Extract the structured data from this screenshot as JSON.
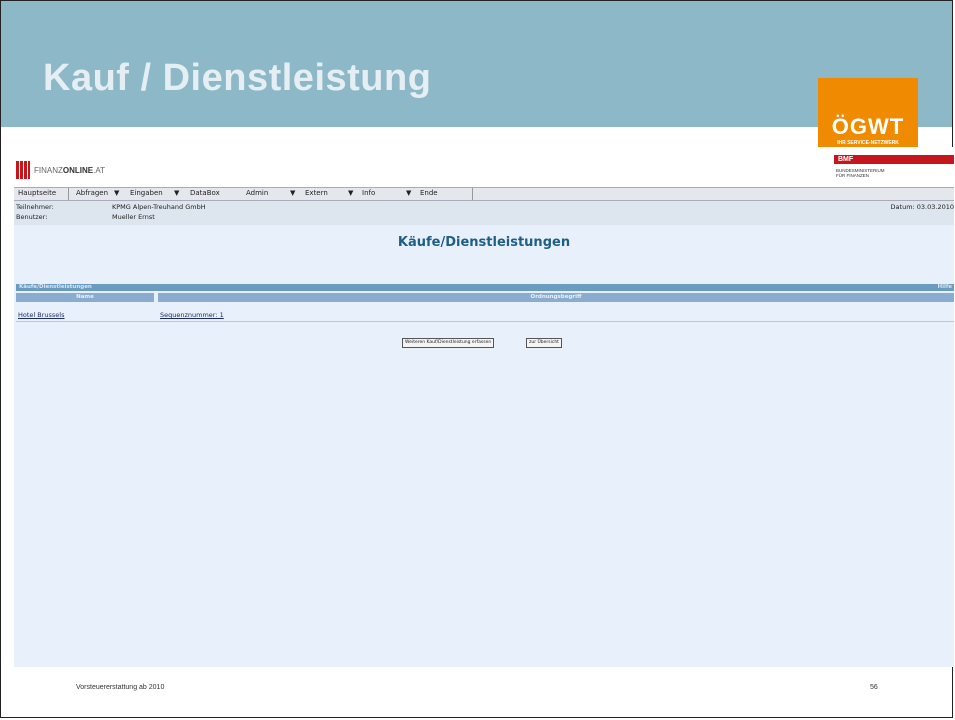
{
  "slide": {
    "title": "Kauf / Dienstleistung",
    "footer_text": "Vorsteuererstattung ab 2010",
    "page_number": "56"
  },
  "ogwt_logo": {
    "name": "ÖGWT",
    "tagline": "IHR SERVICE-NETZWERK"
  },
  "finanzonline": {
    "logo_prefix": "FINANZ",
    "logo_bold": "ONLINE",
    "logo_suffix": ".AT",
    "bmf_logo": "BMF",
    "bmf_line1": "BUNDESMINISTERIUM",
    "bmf_line2": "FÜR FINANZEN",
    "menu": {
      "hauptseite": "Hauptseite",
      "abfragen": "Abfragen",
      "eingaben": "Eingaben",
      "databox": "DataBox",
      "admin": "Admin",
      "extern": "Extern",
      "info": "Info",
      "ende": "Ende"
    },
    "info": {
      "teilnehmer_label": "Teilnehmer:",
      "teilnehmer_value": "KPMG Alpen-Treuhand GmbH",
      "benutzer_label": "Benutzer:",
      "benutzer_value": "Mueller Ernst",
      "datum": "Datum: 03.03.2010"
    },
    "page_heading": "Käufe/Dienstleistungen",
    "table": {
      "title": "Käufe/Dienstleistungen",
      "help": "Hilfe",
      "col_name": "Name",
      "col_ordnungsbegriff": "Ordnungsbegriff",
      "row_name": "Hotel Brussels",
      "row_ordnungsbegriff": "Sequenznummer: 1"
    },
    "buttons": {
      "add": "Weiteren Kauf/Dienstleistung erfassen",
      "overview": "zur Übersicht"
    }
  },
  "colors": {
    "header_bg": "#8db8c8",
    "ogwt_orange": "#f08a00",
    "bmf_red": "#c4161c",
    "content_bg": "#e8f1fb",
    "heading_blue": "#1f5f84"
  }
}
